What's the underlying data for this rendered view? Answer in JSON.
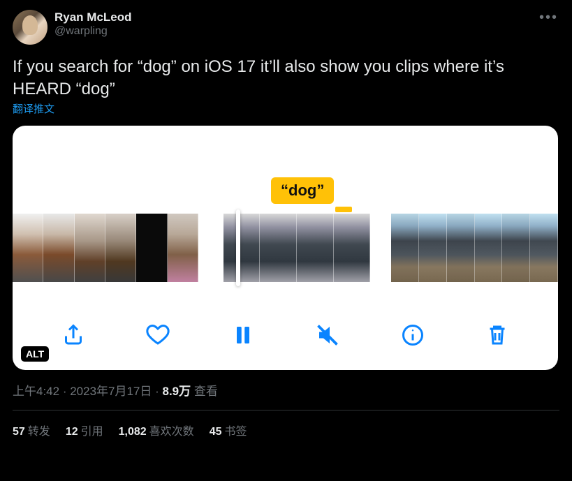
{
  "author": {
    "display_name": "Ryan McLeod",
    "handle": "@warpling"
  },
  "body": "If you search for “dog” on iOS 17 it’ll also show you clips where it’s HEARD “dog”",
  "translate_label": "翻译推文",
  "media": {
    "search_term_label": "“dog”",
    "alt_badge": "ALT",
    "toolbar": {
      "share": "share",
      "like": "like",
      "pause": "pause",
      "mute": "muted",
      "info": "info",
      "delete": "delete"
    }
  },
  "meta": {
    "time": "上午4:42",
    "sep1": " · ",
    "date": "2023年7月17日",
    "sep2": " · ",
    "views_num": "8.9万",
    "views_label": " 查看"
  },
  "stats": {
    "retweets_num": "57",
    "retweets_label": "转发",
    "quotes_num": "12",
    "quotes_label": "引用",
    "likes_num": "1,082",
    "likes_label": "喜欢次数",
    "bookmarks_num": "45",
    "bookmarks_label": "书签"
  }
}
